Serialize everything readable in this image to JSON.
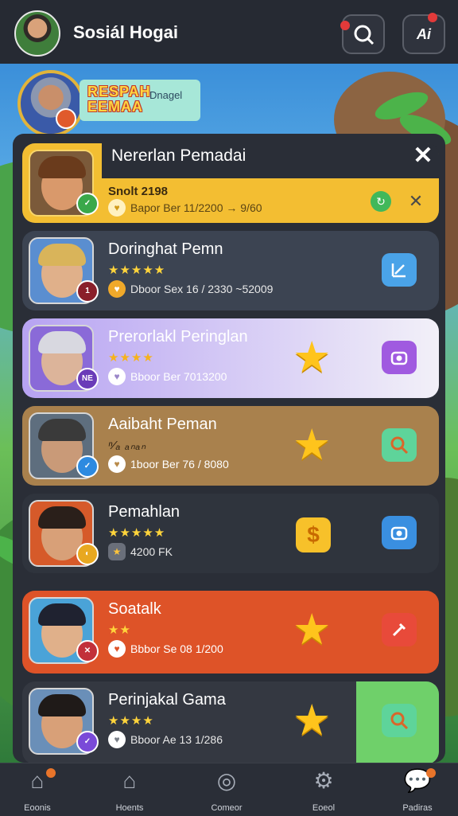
{
  "header": {
    "app_title": "Sosiál Hogai",
    "search_icon": "search-icon",
    "ai_button_label": "Ai",
    "notification_color": "#e23a3a"
  },
  "profile_banner": {
    "logo_line1": "RESPAH",
    "logo_line2": "EEMAA",
    "tagline": "Dnagel"
  },
  "modal": {
    "title": "Nererlan Pemadai",
    "close_label": "✕"
  },
  "cards": [
    {
      "name": "Snolt 2198",
      "stars": "",
      "meta": "Bapor Ber 11/2200 → 9/60",
      "color": "#f3be32"
    },
    {
      "name": "Doringhat Pemn",
      "stars": "★★★★★",
      "meta": "Dboor Sex 16 / 2330 ~52009",
      "color": "#3c4452"
    },
    {
      "name": "Prerorlakl Peringlan",
      "stars": "★★★★",
      "meta": "Bboor Ber 7013200",
      "color": "#e9e2fb"
    },
    {
      "name": "Aaibaht Peman",
      "stars": "ⁿ⁄ₐ ₐₙₐₙ",
      "meta": "1boor Ber 76 / 8080",
      "color": "#a9814d"
    },
    {
      "name": "Pemahlan",
      "stars": "★★★★★",
      "meta": "4200 FK",
      "color": "#2f343d"
    },
    {
      "name": "Soatalk",
      "stars": "★★",
      "meta": "Bbbor Se 08 1/200",
      "color": "#de5328"
    },
    {
      "name": "Perinjakal Gama",
      "stars": "★★★★",
      "meta": "Bboor Ae 13 1/286",
      "color": "#343841"
    }
  ],
  "bottom_nav": [
    {
      "label": "Eoonis",
      "icon": "home-icon"
    },
    {
      "label": "Hoents",
      "icon": "house-icon"
    },
    {
      "label": "Comeor",
      "icon": "community-icon"
    },
    {
      "label": "Eoeol",
      "icon": "settings-icon"
    },
    {
      "label": "Padiras",
      "icon": "chat-icon"
    }
  ]
}
